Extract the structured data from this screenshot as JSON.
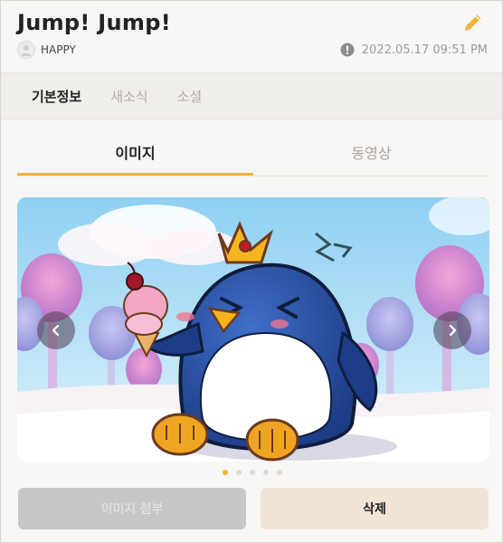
{
  "post": {
    "title": "Jump! Jump!",
    "author": "HAPPY",
    "datetime": "2022.05.17 09:51 PM"
  },
  "nav": {
    "items": [
      {
        "label": "기본정보",
        "active": true
      },
      {
        "label": "새소식",
        "active": false
      },
      {
        "label": "소셜",
        "active": false
      }
    ]
  },
  "media_tabs": [
    {
      "label": "이미지",
      "active": true
    },
    {
      "label": "동영상",
      "active": false
    }
  ],
  "gallery": {
    "current_index": 1,
    "total": 5
  },
  "buttons": {
    "attach_label": "이미지 첨부",
    "delete_label": "삭제"
  },
  "colors": {
    "accent": "#f0b43a",
    "page_bg": "#f8f7f5",
    "disabled_button": "#c7c7c7",
    "delete_button": "#f1e5d8"
  },
  "icons": [
    "pencil-icon",
    "avatar-icon",
    "alert-icon",
    "chevron-left-icon",
    "chevron-right-icon"
  ]
}
